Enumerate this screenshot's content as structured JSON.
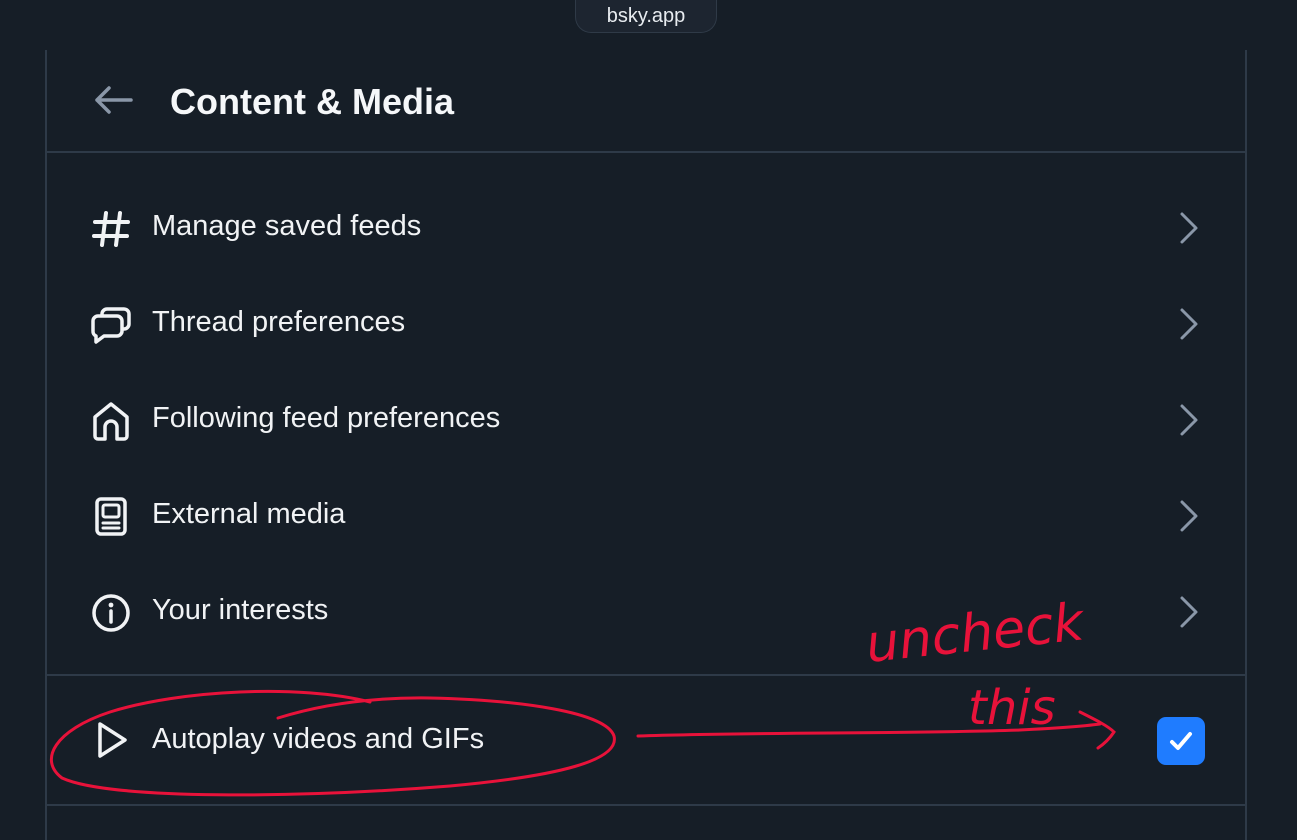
{
  "browser": {
    "url": "bsky.app"
  },
  "header": {
    "title": "Content & Media",
    "back_icon": "arrow-left-icon"
  },
  "menu": {
    "items": [
      {
        "label": "Manage saved feeds",
        "icon": "hashtag-icon"
      },
      {
        "label": "Thread preferences",
        "icon": "chat-bubbles-icon"
      },
      {
        "label": "Following feed preferences",
        "icon": "home-icon"
      },
      {
        "label": "External media",
        "icon": "media-device-icon"
      },
      {
        "label": "Your interests",
        "icon": "info-circle-icon"
      }
    ]
  },
  "autoplay": {
    "label": "Autoplay videos and GIFs",
    "icon": "play-icon",
    "checked": true
  },
  "annotation": {
    "text_line1": "uncheck",
    "text_line2": "this",
    "color": "#e8123a"
  },
  "colors": {
    "background": "#161e27",
    "divider": "#2e3a48",
    "accent": "#1f7cff",
    "chevron": "#8a97a8"
  }
}
